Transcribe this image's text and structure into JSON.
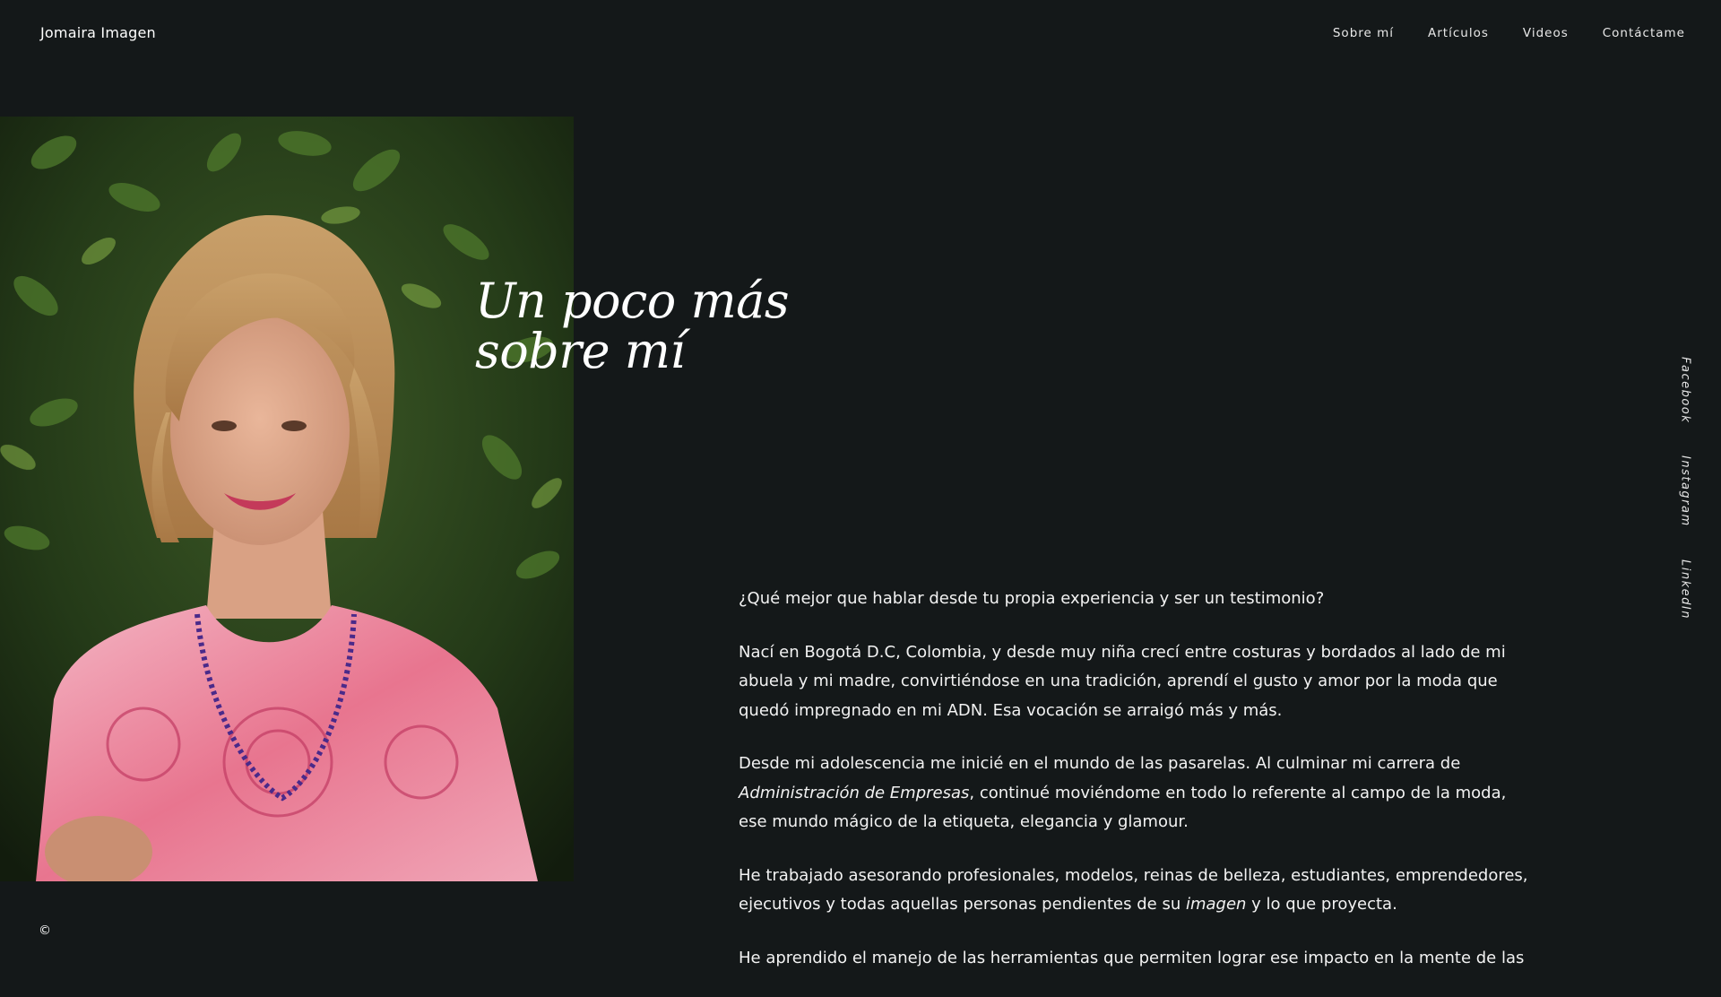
{
  "header": {
    "brand": "Jomaira Imagen",
    "nav": [
      "Sobre mí",
      "Artículos",
      "Videos",
      "Contáctame"
    ]
  },
  "hero": {
    "title_line1": "Un poco más",
    "title_line2": "sobre mí"
  },
  "social": [
    "Facebook",
    "Instagram",
    "LinkedIn"
  ],
  "footer": {
    "copyright": "©"
  },
  "bio": {
    "p1": "¿Qué mejor que hablar desde tu propia experiencia y ser un testimonio?",
    "p2": "Nací en Bogotá D.C, Colombia, y desde muy niña crecí entre costuras y bordados al lado de mi abuela y mi madre, convirtiéndose en una tradición, aprendí el gusto y amor por la moda que quedó impregnado en mi ADN. Esa vocación se arraigó más y más.",
    "p3_a": "Desde mi adolescencia me inicié en el mundo de las pasarelas. Al culminar mi carrera de ",
    "p3_em": "Administración de Empresas",
    "p3_b": ", continué moviéndome en todo lo referente al campo de la moda, ese mundo mágico de la etiqueta, elegancia y glamour.",
    "p4_a": "He trabajado asesorando profesionales, modelos, reinas de belleza, estudiantes, emprendedores, ejecutivos y todas aquellas personas pendientes de su ",
    "p4_em": "imagen",
    "p4_b": " y lo que proyecta.",
    "p5": "He aprendido el manejo de las herramientas que permiten lograr ese impacto en la mente de las"
  },
  "colors": {
    "background": "#141819",
    "text": "#ffffff"
  }
}
